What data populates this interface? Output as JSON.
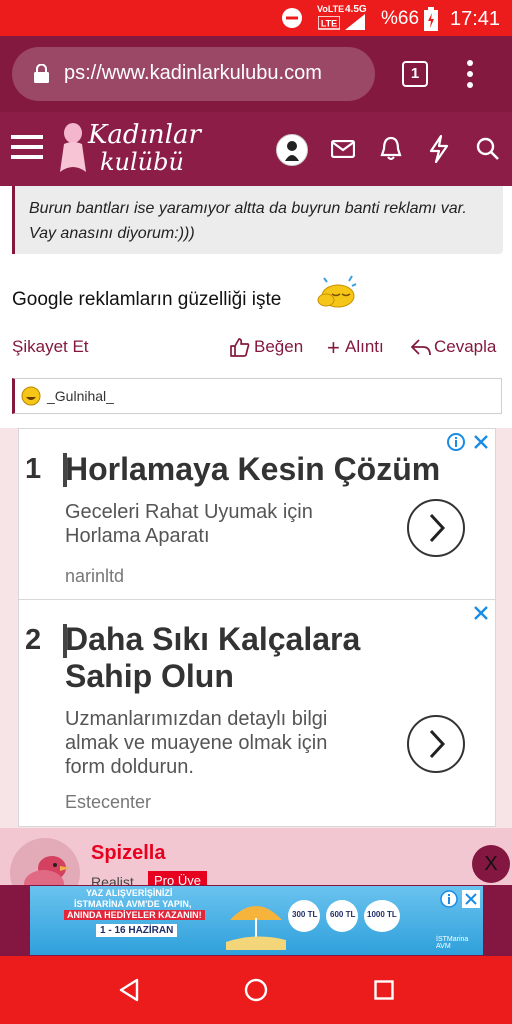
{
  "status_bar": {
    "network": "4.5G",
    "volte": "VoLTE",
    "battery": "%66",
    "time": "17:41"
  },
  "browser": {
    "url": "ps://www.kadinlarkulubu.com",
    "tab_count": "1"
  },
  "site": {
    "logo_line1": "Kadınlar",
    "logo_line2": "kulübü"
  },
  "post": {
    "quote_text": "Burun bantları ise yaramıyor altta da buyrun banti reklamı var. Vay anasını diyorum:)))",
    "body_text": "Google reklamların güzelliği işte",
    "report_label": "Şikayet Et",
    "like_label": "Beğen",
    "quote_label": "Alıntı",
    "reply_label": "Cevapla",
    "reaction_user": "_Gulnihal_"
  },
  "ads": [
    {
      "number": "1",
      "title": "Horlamaya Kesin Çözüm",
      "desc_line1": "Geceleri Rahat Uyumak için",
      "desc_line2": "Horlama Aparatı",
      "source": "narinltd"
    },
    {
      "number": "2",
      "title_line1": "Daha Sıkı Kalçalara",
      "title_line2": "Sahip Olun",
      "desc_line1": "Uzmanlarımızdan detaylı bilgi",
      "desc_line2": "almak ve muayene olmak için",
      "desc_line3": "form doldurun.",
      "source": "Estecenter"
    }
  ],
  "next_post": {
    "username": "Spizella",
    "rank": "Realist",
    "badge": "Pro Üye",
    "close_label": "X"
  },
  "banner": {
    "headline1": "YAZ ALIŞVERİŞİNİZİ",
    "headline2": "İSTMARİNA AVM'DE YAPIN,",
    "headline3": "ANINDA HEDİYELER KAZANIN!",
    "dates": "1 - 16 HAZİRAN",
    "brand": "İSTMarina AVM",
    "gift1": "300 TL",
    "gift2": "600 TL",
    "gift3": "1000 TL"
  },
  "colors": {
    "status_red": "#ed1c1c",
    "brand_maroon": "#84193f",
    "header_maroon": "#8b1d46",
    "accent_red": "#e8001f",
    "ad_blue": "#1a8ce5"
  }
}
